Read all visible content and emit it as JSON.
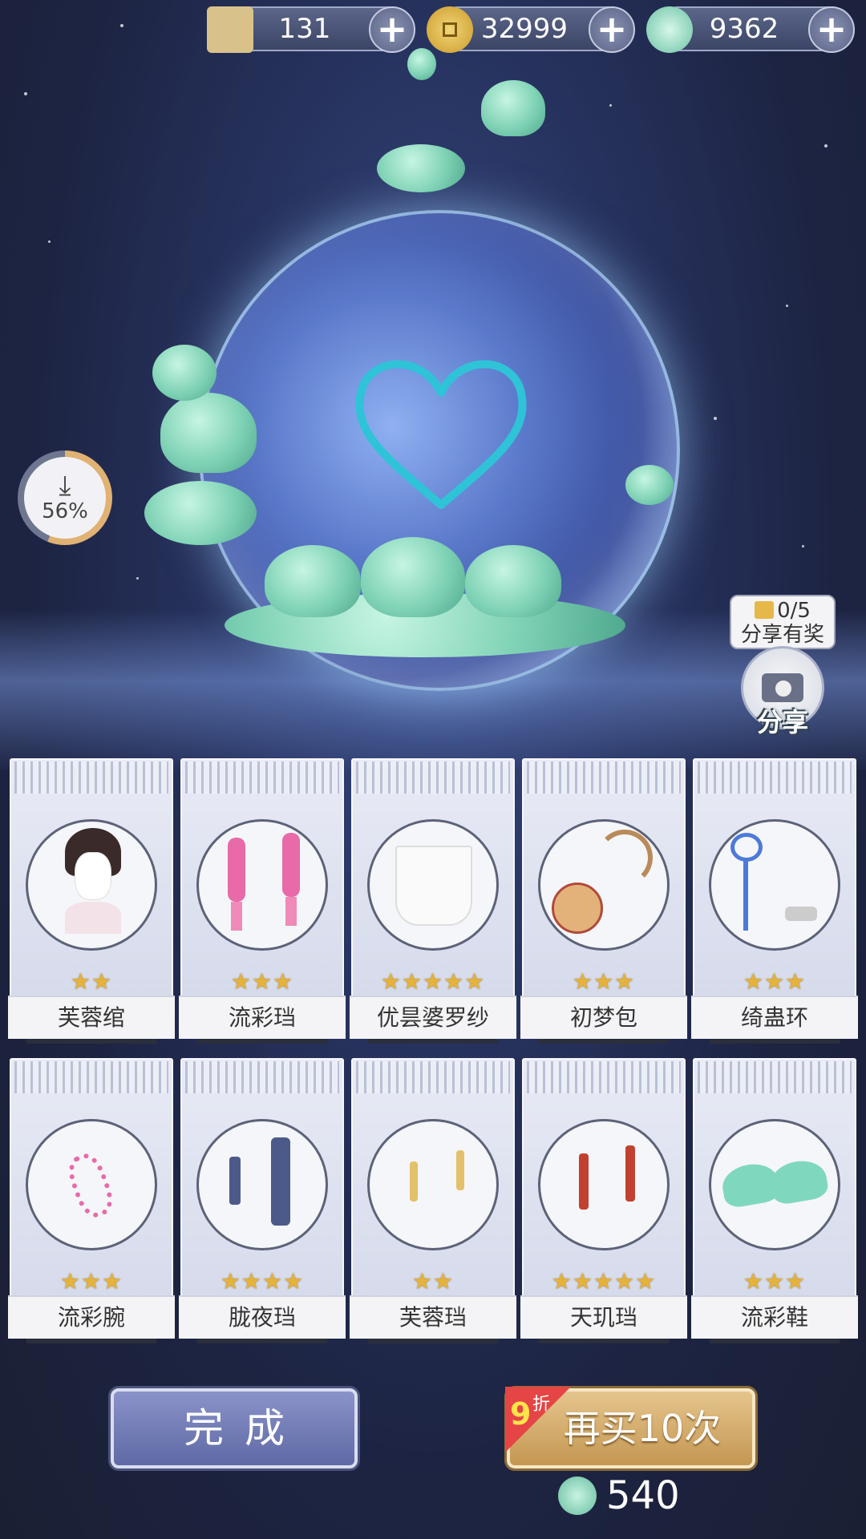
{
  "currencies": [
    {
      "icon": "scroll-ticket-icon",
      "value": "131",
      "color": "#d9c28a"
    },
    {
      "icon": "gold-coin-icon",
      "value": "32999",
      "color": "#e8c14a"
    },
    {
      "icon": "jade-swirl-icon",
      "value": "9362",
      "color": "#7fd2b5"
    }
  ],
  "download": {
    "percent": 56,
    "label": "56%"
  },
  "share": {
    "badge_count": "0/5",
    "badge_text": "分享有奖",
    "label": "分享"
  },
  "items": [
    {
      "name": "芙蓉绾",
      "stars": "★★",
      "art": "hair"
    },
    {
      "name": "流彩珰",
      "stars": "★★★",
      "art": "earrings-pink"
    },
    {
      "name": "优昙婆罗纱",
      "stars": "★★★★★",
      "art": "veil"
    },
    {
      "name": "初梦包",
      "stars": "★★★",
      "art": "bag"
    },
    {
      "name": "绮蛊环",
      "stars": "★★★",
      "art": "ribbon"
    },
    {
      "name": "流彩腕",
      "stars": "★★★",
      "art": "bracelet"
    },
    {
      "name": "胧夜珰",
      "stars": "★★★★",
      "art": "tassel"
    },
    {
      "name": "芙蓉珰",
      "stars": "★★",
      "art": "earrings-gold"
    },
    {
      "name": "天玑珰",
      "stars": "★★★★★",
      "art": "earrings-red"
    },
    {
      "name": "流彩鞋",
      "stars": "★★★",
      "art": "shoes"
    }
  ],
  "buttons": {
    "done": "完成",
    "buy_again": "再买10次"
  },
  "discount": {
    "number": "9",
    "unit": "折"
  },
  "cost": {
    "icon": "jade-swirl-icon",
    "value": "540"
  }
}
